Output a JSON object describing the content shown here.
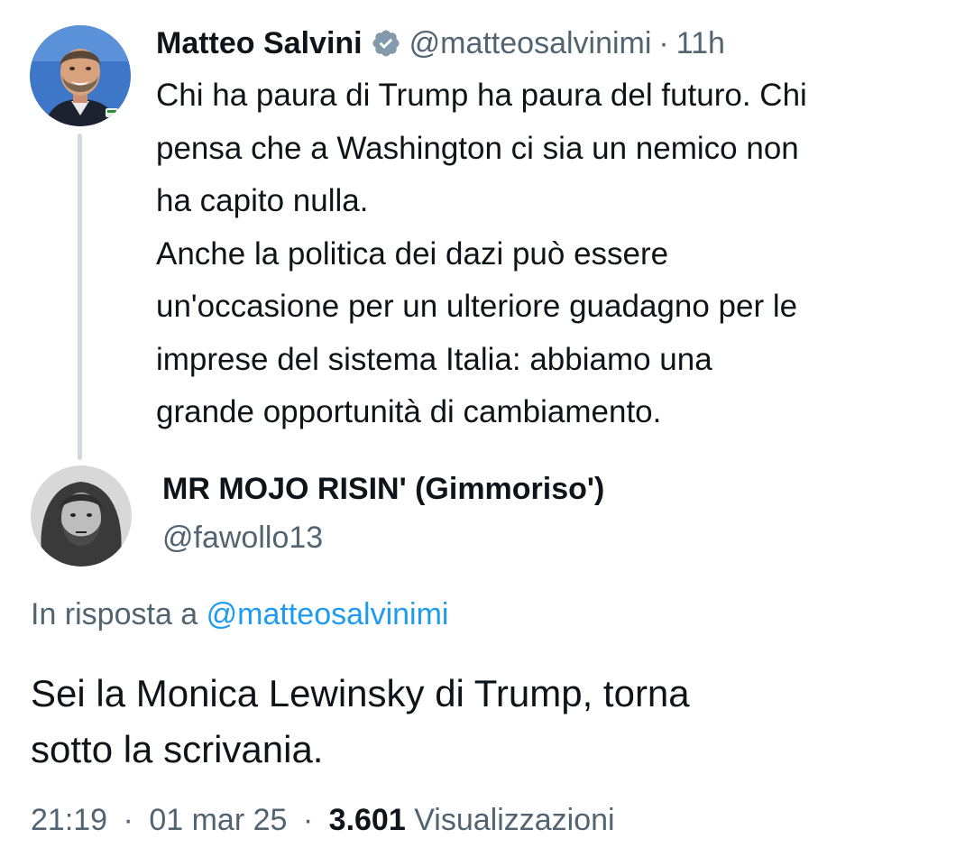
{
  "parent_tweet": {
    "author_name": "Matteo Salvini",
    "handle": "@matteosalvinimi",
    "separator": "·",
    "time_ago": "11h",
    "verified_icon": "verified-badge-icon",
    "text_paragraph_1": "Chi ha paura di Trump ha paura del futuro. Chi\npensa che a Washington ci sia un nemico non\nha capito nulla.",
    "text_paragraph_2": "Anche la politica dei dazi può essere\nun'occasione per un ulteriore guadagno per le\nimprese del sistema Italia: abbiamo una\ngrande opportunità di cambiamento."
  },
  "reply_tweet": {
    "author_name": "MR MOJO RISIN' (Gimmoriso')",
    "handle": "@fawollo13",
    "reply_context_prefix": "In risposta a",
    "reply_context_mention": "@matteosalvinimi",
    "text": "Sei la Monica Lewinsky di Trump, torna\nsotto la scrivania.",
    "time": "21:19",
    "date": "01 mar 25",
    "separator": "·",
    "views_count": "3.601",
    "views_label": "Visualizzazioni"
  },
  "colors": {
    "text_primary": "#0f1419",
    "text_secondary": "#536471",
    "link": "#1d9bf0",
    "thread_line": "#cfd9de",
    "verified_badge": "#829aab"
  }
}
